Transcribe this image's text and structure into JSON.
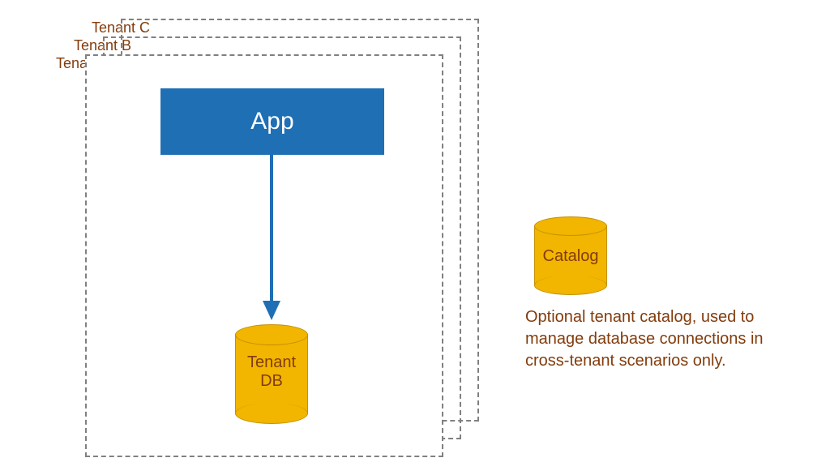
{
  "tenants": {
    "a": "Tenant A",
    "b": "Tenant B",
    "c": "Tenant C"
  },
  "app": {
    "label": "App"
  },
  "tenantDb": {
    "line1": "Tenant",
    "line2": "DB"
  },
  "catalog": {
    "label": "Catalog",
    "description": "Optional tenant catalog, used to manage database connections in cross-tenant scenarios only."
  },
  "colors": {
    "accent_text": "#833c0c",
    "app_bg": "#1f6fb5",
    "cylinder": "#f2b500",
    "arrow": "#1f6fb5",
    "dashed": "#808080"
  }
}
